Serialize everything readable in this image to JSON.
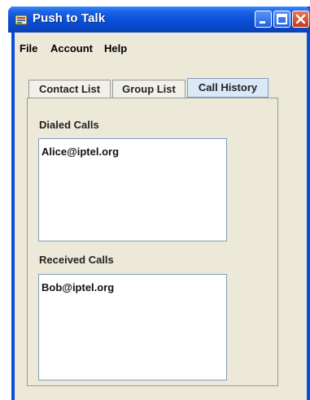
{
  "window": {
    "title": "Push to Talk",
    "icon": "app-icon",
    "controls": [
      "minimize-icon",
      "maximize-icon",
      "close-icon"
    ]
  },
  "menu": {
    "file": "File",
    "account": "Account",
    "help": "Help"
  },
  "tabs": [
    {
      "label": "Contact List",
      "selected": false
    },
    {
      "label": "Group List",
      "selected": false
    },
    {
      "label": "Call History",
      "selected": true
    }
  ],
  "call_history": {
    "dialed_label": "Dialed Calls",
    "dialed_items": [
      "Alice@iptel.org"
    ],
    "received_label": "Received Calls",
    "received_items": [
      "Bob@iptel.org"
    ]
  },
  "colors": {
    "title_bar": "#0a50d9",
    "window_bg": "#ece9d8",
    "close_button": "#c2381a"
  }
}
